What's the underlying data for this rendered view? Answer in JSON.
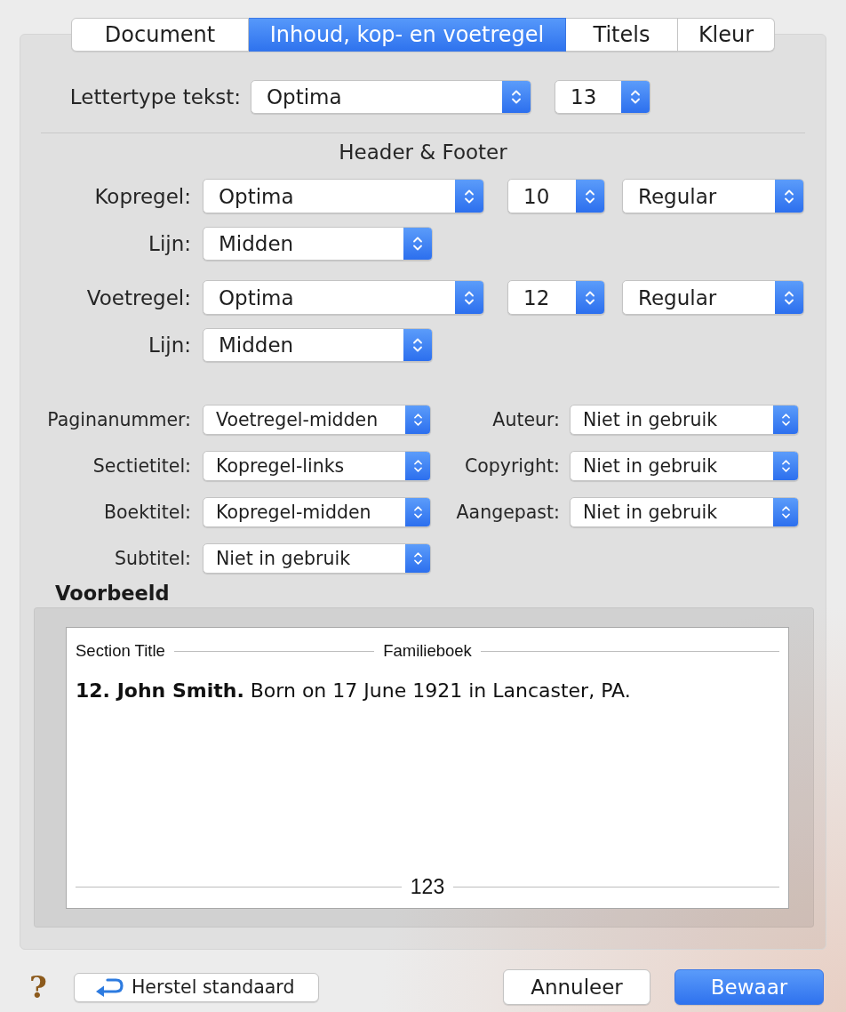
{
  "tabs": [
    {
      "label": "Document",
      "selected": false
    },
    {
      "label": "Inhoud, kop- en voetregel",
      "selected": true
    },
    {
      "label": "Titels",
      "selected": false
    },
    {
      "label": "Kleur",
      "selected": false
    }
  ],
  "text_font": {
    "label": "Lettertype tekst:",
    "font": "Optima",
    "size": "13"
  },
  "header_footer": {
    "title": "Header & Footer",
    "rows": [
      {
        "label": "Kopregel:",
        "font": "Optima",
        "size": "10",
        "style": "Regular",
        "line_label": "Lijn:",
        "line": "Midden"
      },
      {
        "label": "Voetregel:",
        "font": "Optima",
        "size": "12",
        "style": "Regular",
        "line_label": "Lijn:",
        "line": "Midden"
      }
    ]
  },
  "placements": {
    "left": [
      {
        "label": "Paginanummer:",
        "value": "Voetregel-midden"
      },
      {
        "label": "Sectietitel:",
        "value": "Kopregel-links"
      },
      {
        "label": "Boektitel:",
        "value": "Kopregel-midden"
      },
      {
        "label": "Subtitel:",
        "value": "Niet in gebruik"
      }
    ],
    "right": [
      {
        "label": "Auteur:",
        "value": "Niet in gebruik"
      },
      {
        "label": "Copyright:",
        "value": "Niet in gebruik"
      },
      {
        "label": "Aangepast:",
        "value": "Niet in gebruik"
      }
    ]
  },
  "preview": {
    "title": "Voorbeeld",
    "header_left": "Section Title",
    "header_center": "Familieboek",
    "body": "**12. John Smith.** Born on 17 June 1921 in Lancaster, PA.",
    "footer_center": "123"
  },
  "help_button": {
    "label": "?"
  },
  "buttons": [
    {
      "label": "Herstel standaard",
      "kind": "reset"
    },
    {
      "label": "Annuleer",
      "kind": "cancel"
    },
    {
      "label": "Bewaar",
      "kind": "confirm"
    }
  ]
}
